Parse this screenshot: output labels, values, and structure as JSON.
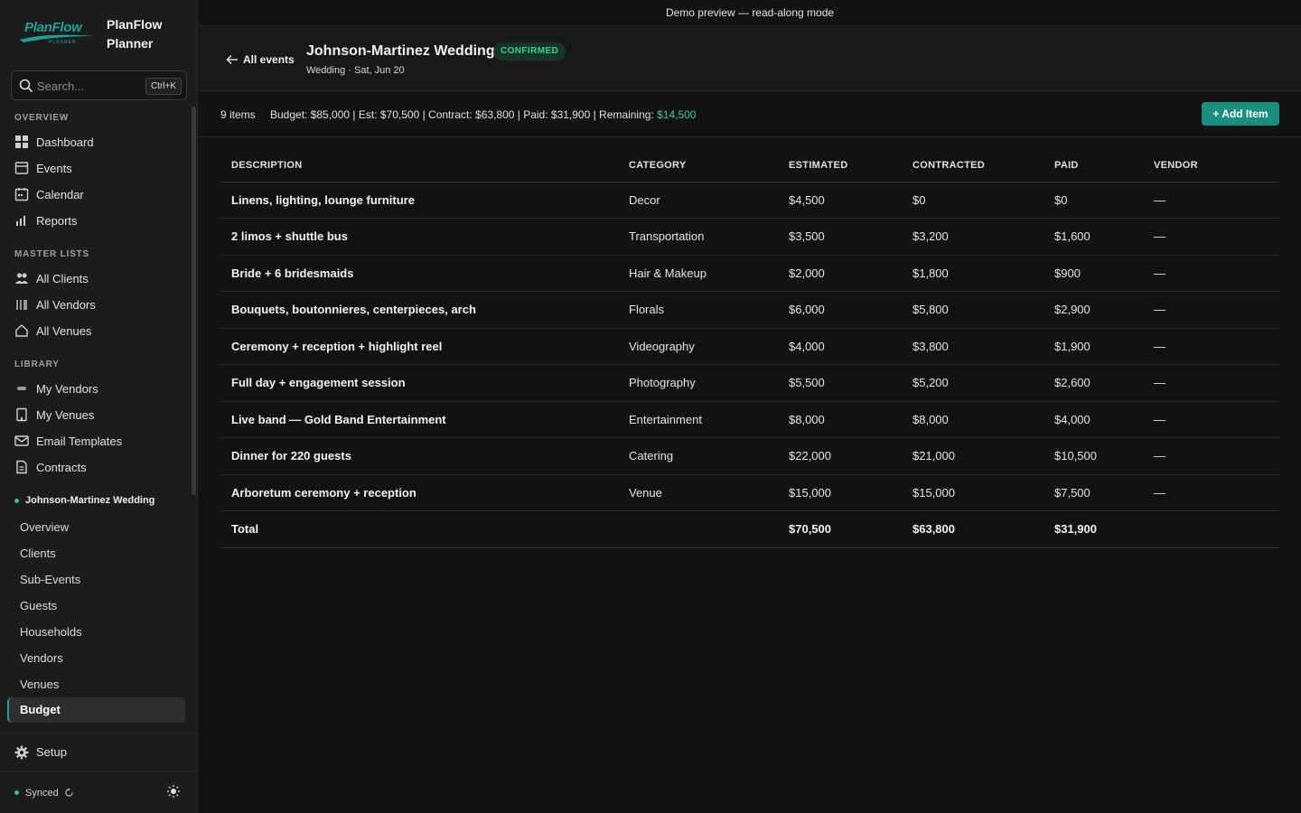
{
  "app": {
    "logo_text": "PlanFlow",
    "logo_sub": "PLANNER",
    "name": "PlanFlow Planner"
  },
  "search": {
    "placeholder": "Search...",
    "shortcut": "Ctrl+K"
  },
  "sidebar": {
    "overview_title": "OVERVIEW",
    "overview": [
      {
        "label": "Dashboard",
        "icon": "grid-icon"
      },
      {
        "label": "Events",
        "icon": "events-icon"
      },
      {
        "label": "Calendar",
        "icon": "calendar-icon"
      },
      {
        "label": "Reports",
        "icon": "bar-chart-icon"
      }
    ],
    "master_title": "MASTER LISTS",
    "master": [
      {
        "label": "All Clients",
        "icon": "users-icon"
      },
      {
        "label": "All Vendors",
        "icon": "vendors-icon"
      },
      {
        "label": "All Venues",
        "icon": "home-icon"
      }
    ],
    "library_title": "LIBRARY",
    "library": [
      {
        "label": "My Vendors",
        "icon": "tag-icon"
      },
      {
        "label": "My Venues",
        "icon": "building-icon"
      },
      {
        "label": "Email Templates",
        "icon": "mail-icon"
      },
      {
        "label": "Contracts",
        "icon": "document-icon"
      }
    ],
    "event_title": "Johnson-Martinez Wedding",
    "event_items": [
      "Overview",
      "Clients",
      "Sub-Events",
      "Guests",
      "Households",
      "Vendors",
      "Venues"
    ],
    "active_item": "Budget",
    "setup": "Setup",
    "sync_status": "Synced"
  },
  "banner": "Demo preview — read-along mode",
  "header": {
    "back_label": "All events",
    "event_name": "Johnson-Martinez Wedding",
    "status": "CONFIRMED",
    "subtitle": "Wedding · Sat, Jun 20"
  },
  "toolbar": {
    "count": "9 items",
    "summary": "Budget: $85,000 | Est: $70,500 | Contract: $63,800 | Paid: $31,900 | Remaining: ",
    "remaining": "$14,500",
    "add_label": "+ Add Item"
  },
  "table": {
    "headers": [
      "DESCRIPTION",
      "CATEGORY",
      "ESTIMATED",
      "CONTRACTED",
      "PAID",
      "VENDOR"
    ],
    "rows": [
      [
        "Linens, lighting, lounge furniture",
        "Decor",
        "$4,500",
        "$0",
        "$0",
        "—"
      ],
      [
        "2 limos + shuttle bus",
        "Transportation",
        "$3,500",
        "$3,200",
        "$1,600",
        "—"
      ],
      [
        "Bride + 6 bridesmaids",
        "Hair & Makeup",
        "$2,000",
        "$1,800",
        "$900",
        "—"
      ],
      [
        "Bouquets, boutonnieres, centerpieces, arch",
        "Florals",
        "$6,000",
        "$5,800",
        "$2,900",
        "—"
      ],
      [
        "Ceremony + reception + highlight reel",
        "Videography",
        "$4,000",
        "$3,800",
        "$1,900",
        "—"
      ],
      [
        "Full day + engagement session",
        "Photography",
        "$5,500",
        "$5,200",
        "$2,600",
        "—"
      ],
      [
        "Live band — Gold Band Entertainment",
        "Entertainment",
        "$8,000",
        "$8,000",
        "$4,000",
        "—"
      ],
      [
        "Dinner for 220 guests",
        "Catering",
        "$22,000",
        "$21,000",
        "$10,500",
        "—"
      ],
      [
        "Arboretum ceremony + reception",
        "Venue",
        "$15,000",
        "$15,000",
        "$7,500",
        "—"
      ]
    ],
    "total": {
      "label": "Total",
      "estimated": "$70,500",
      "contracted": "$63,800",
      "paid": "$31,900"
    }
  }
}
